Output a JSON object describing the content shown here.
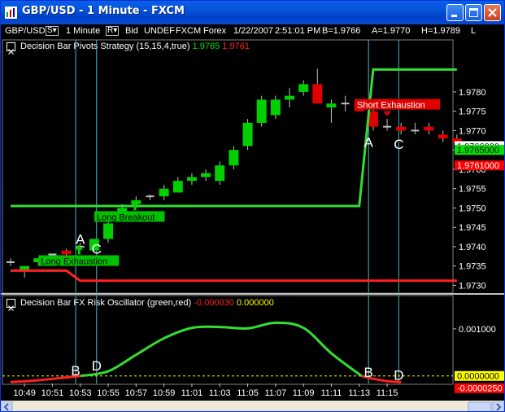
{
  "window": {
    "title": "GBP/USD - 1 Minute - FXCM",
    "minimize_icon": "minimize-icon",
    "maximize_icon": "maximize-icon",
    "close_icon": "close-icon"
  },
  "toolbar": {
    "symbol": "GBP/USD",
    "s_button": "S▾",
    "interval": "1 Minute",
    "r_button": "R▾",
    "side": "Bid",
    "undef": "UNDEF",
    "broker": "FXCM",
    "market": "Forex",
    "date": "1/22/2007",
    "time": "2:51:01 PM",
    "bid": "B=1.9766",
    "ask": "A=1.9770",
    "high": "H=1.9789",
    "low": "L"
  },
  "indicators": {
    "strategy": {
      "name": "Decision Bar Pivots Strategy",
      "params": "(15,15,4,true)",
      "value1": "1.9765",
      "value2": "1.9761",
      "color1": "#00e000",
      "color2": "#ff2020"
    },
    "oscillator": {
      "name": "Decision Bar FX Risk Oscillator",
      "params": "(green,red)",
      "value1": "-0.000030",
      "value2": "0.000000",
      "color1": "#ff2020",
      "color2": "#ffff00"
    }
  },
  "chart_data": [
    {
      "type": "candlestick",
      "price_axis_ticks": [
        "1.9780",
        "1.9775",
        "1.9770",
        "1.9765",
        "1.9760",
        "1.9755",
        "1.9750",
        "1.9745",
        "1.9740",
        "1.9735",
        "1.9730"
      ],
      "price_badges": [
        {
          "text": "1.9766000",
          "bg": "#ffffff",
          "fg": "#000000"
        },
        {
          "text": "1.9765000",
          "bg": "#00e000",
          "fg": "#000000"
        },
        {
          "text": "1.9761000",
          "bg": "#ff0000",
          "fg": "#ffffff"
        }
      ],
      "ylim": [
        1.97282,
        1.97905
      ],
      "time_ticks": [
        "10:49",
        "10:51",
        "10:53",
        "10:55",
        "10:57",
        "10:59",
        "11:01",
        "11:03",
        "11:05",
        "11:07",
        "11:09",
        "11:11",
        "11:13",
        "11:15"
      ],
      "candles": [
        {
          "t": "10:48",
          "o": 1.9736,
          "h": 1.9737,
          "l": 1.9735,
          "c": 1.9736
        },
        {
          "t": "10:49",
          "o": 1.9734,
          "h": 1.9735,
          "l": 1.9732,
          "c": 1.9735
        },
        {
          "t": "10:50",
          "o": 1.9736,
          "h": 1.9737,
          "l": 1.9735,
          "c": 1.9737
        },
        {
          "t": "10:51",
          "o": 1.9738,
          "h": 1.9738,
          "l": 1.9737,
          "c": 1.9738
        },
        {
          "t": "10:52",
          "o": 1.9739,
          "h": 1.97395,
          "l": 1.9737,
          "c": 1.9738
        },
        {
          "t": "10:53",
          "o": 1.974,
          "h": 1.9741,
          "l": 1.9739,
          "c": 1.974
        },
        {
          "t": "10:54",
          "o": 1.9739,
          "h": 1.9742,
          "l": 1.9739,
          "c": 1.9742
        },
        {
          "t": "10:55",
          "o": 1.9742,
          "h": 1.9747,
          "l": 1.9741,
          "c": 1.9746
        },
        {
          "t": "10:56",
          "o": 1.9748,
          "h": 1.9751,
          "l": 1.9747,
          "c": 1.975
        },
        {
          "t": "10:57",
          "o": 1.9751,
          "h": 1.9753,
          "l": 1.975,
          "c": 1.9752
        },
        {
          "t": "10:58",
          "o": 1.9753,
          "h": 1.97535,
          "l": 1.9752,
          "c": 1.9753
        },
        {
          "t": "10:59",
          "o": 1.9753,
          "h": 1.9756,
          "l": 1.9752,
          "c": 1.9755
        },
        {
          "t": "11:00",
          "o": 1.9754,
          "h": 1.9758,
          "l": 1.9754,
          "c": 1.9757
        },
        {
          "t": "11:01",
          "o": 1.9757,
          "h": 1.9759,
          "l": 1.9756,
          "c": 1.9758
        },
        {
          "t": "11:02",
          "o": 1.9758,
          "h": 1.976,
          "l": 1.9757,
          "c": 1.9759
        },
        {
          "t": "11:03",
          "o": 1.9757,
          "h": 1.9762,
          "l": 1.9756,
          "c": 1.9761
        },
        {
          "t": "11:04",
          "o": 1.9761,
          "h": 1.9766,
          "l": 1.976,
          "c": 1.9765
        },
        {
          "t": "11:05",
          "o": 1.9766,
          "h": 1.9773,
          "l": 1.9765,
          "c": 1.9772
        },
        {
          "t": "11:06",
          "o": 1.9772,
          "h": 1.9779,
          "l": 1.9771,
          "c": 1.9778
        },
        {
          "t": "11:07",
          "o": 1.9774,
          "h": 1.9779,
          "l": 1.9773,
          "c": 1.9778
        },
        {
          "t": "11:08",
          "o": 1.9778,
          "h": 1.9781,
          "l": 1.9776,
          "c": 1.9779
        },
        {
          "t": "11:09",
          "o": 1.978,
          "h": 1.9783,
          "l": 1.9779,
          "c": 1.9782
        },
        {
          "t": "11:10",
          "o": 1.9782,
          "h": 1.9786,
          "l": 1.978,
          "c": 1.9777
        },
        {
          "t": "11:11",
          "o": 1.9776,
          "h": 1.9778,
          "l": 1.9772,
          "c": 1.9777
        },
        {
          "t": "11:12",
          "o": 1.9777,
          "h": 1.9779,
          "l": 1.9775,
          "c": 1.9777
        },
        {
          "t": "11:13",
          "o": 1.9777,
          "h": 1.9778,
          "l": 1.9775,
          "c": 1.9775
        },
        {
          "t": "11:14",
          "o": 1.9775,
          "h": 1.9777,
          "l": 1.977,
          "c": 1.9771
        },
        {
          "t": "11:15",
          "o": 1.9771,
          "h": 1.9773,
          "l": 1.977,
          "c": 1.9771
        },
        {
          "t": "11:16",
          "o": 1.9771,
          "h": 1.9772,
          "l": 1.9769,
          "c": 1.977
        },
        {
          "t": "11:17",
          "o": 1.977,
          "h": 1.9772,
          "l": 1.9769,
          "c": 1.977
        },
        {
          "t": "11:18",
          "o": 1.9771,
          "h": 1.9772,
          "l": 1.9769,
          "c": 1.977
        },
        {
          "t": "11:19",
          "o": 1.9769,
          "h": 1.977,
          "l": 1.9767,
          "c": 1.9768
        },
        {
          "t": "11:20",
          "o": 1.9768,
          "h": 1.9769,
          "l": 1.9766,
          "c": 1.9767
        }
      ],
      "pivot_lines": [
        {
          "name": "green",
          "color": "#33dd33",
          "points": [
            [
              "10:48",
              1.97505
            ],
            [
              "11:13",
              1.97505
            ],
            [
              "11:14",
              1.97858
            ],
            [
              "11:20",
              1.97858
            ]
          ]
        },
        {
          "name": "red",
          "color": "#ff2020",
          "points": [
            [
              "10:48",
              1.97338
            ],
            [
              "10:52",
              1.97338
            ],
            [
              "10:53",
              1.97312
            ],
            [
              "11:20",
              1.97312
            ]
          ]
        }
      ],
      "vertical_markers": [
        "10:52:40",
        "10:54:10",
        "11:13:40",
        "11:15:50"
      ],
      "labels": [
        {
          "text": "A",
          "t": "10:53",
          "price": 1.9742
        },
        {
          "text": "C",
          "t": "10:54:10",
          "price": 1.97395
        },
        {
          "text": "A",
          "t": "11:13:40",
          "price": 1.9767
        },
        {
          "text": "C",
          "t": "11:15:50",
          "price": 1.97665
        }
      ],
      "signals": [
        {
          "text": "Long Exhaustion",
          "t": "10:50",
          "price": 1.97363,
          "style": "green"
        },
        {
          "text": "Long Breakout",
          "t": "10:54",
          "price": 1.97477,
          "style": "green"
        },
        {
          "text": "Short Exhaustion",
          "t": "11:12:40",
          "price": 1.97767,
          "style": "red"
        }
      ]
    },
    {
      "type": "line",
      "axis_ticks": [
        "0.001000"
      ],
      "value_badges": [
        {
          "text": "0.0000000",
          "bg": "#ffff00",
          "fg": "#000000"
        },
        {
          "text": "-0.0000250",
          "bg": "#ff0000",
          "fg": "#ffffff"
        }
      ],
      "ylim": [
        -0.00016,
        0.00143
      ],
      "zero_line": {
        "value": 0.0,
        "color": "#ffff00",
        "style": "dashed"
      },
      "series": [
        {
          "color": "#ff2020",
          "points": [
            [
              "10:48",
              -0.00013
            ],
            [
              "10:50",
              -9e-05
            ],
            [
              "10:52",
              -3e-05
            ],
            [
              "10:53",
              0.0
            ]
          ]
        },
        {
          "color": "#33dd33",
          "points": [
            [
              "10:53",
              0.0
            ],
            [
              "10:55",
              0.0001
            ],
            [
              "10:57",
              0.00045
            ],
            [
              "10:59",
              0.0008
            ],
            [
              "11:01",
              0.00102
            ],
            [
              "11:03",
              0.00104
            ],
            [
              "11:05",
              0.00101
            ],
            [
              "11:07",
              0.00113
            ],
            [
              "11:09",
              0.00102
            ],
            [
              "11:11",
              0.00048
            ],
            [
              "11:13:10",
              0.0
            ]
          ]
        },
        {
          "color": "#ff2020",
          "points": [
            [
              "11:13:10",
              0.0
            ],
            [
              "11:14",
              -6e-05
            ],
            [
              "11:15",
              -0.00011
            ],
            [
              "11:16",
              -0.00013
            ]
          ]
        }
      ],
      "labels": [
        {
          "text": "B",
          "t": "10:52:40",
          "value": 0.00012
        },
        {
          "text": "D",
          "t": "10:54:10",
          "value": 0.00022
        },
        {
          "text": "B",
          "t": "11:13:40",
          "value": 8e-05
        },
        {
          "text": "D",
          "t": "11:15:50",
          "value": 2e-05
        }
      ]
    }
  ]
}
